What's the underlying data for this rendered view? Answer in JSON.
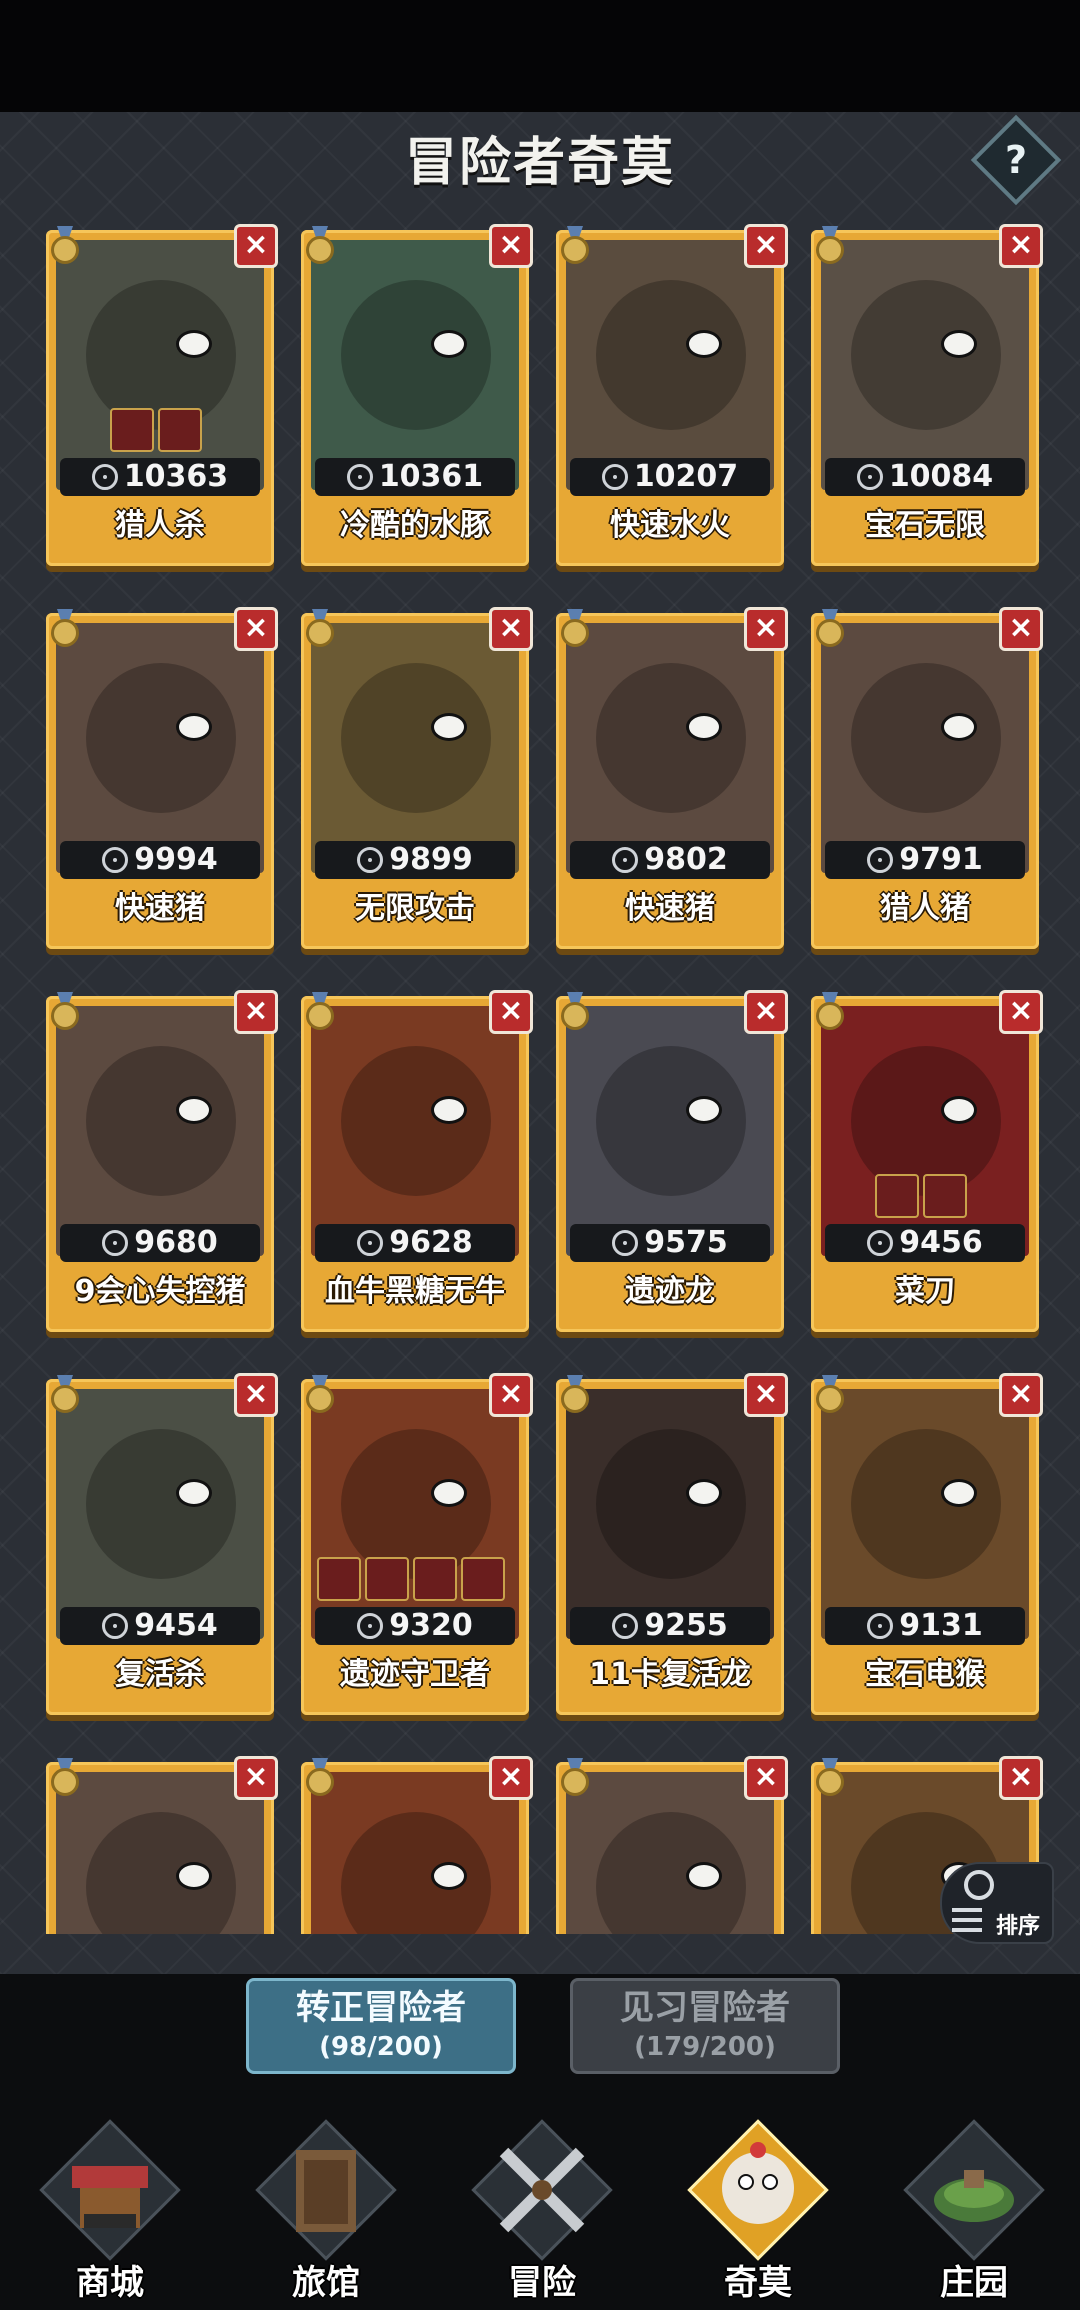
{
  "header": {
    "title": "冒险者奇莫",
    "help_label": "?"
  },
  "cards": [
    {
      "power": "10363",
      "name": "猎人杀",
      "art": "#4b4f45"
    },
    {
      "power": "10361",
      "name": "冷酷的水豚",
      "art": "#3f5a4a"
    },
    {
      "power": "10207",
      "name": "快速水火",
      "art": "#5a4c3e"
    },
    {
      "power": "10084",
      "name": "宝石无限",
      "art": "#5a5046"
    },
    {
      "power": "9994",
      "name": "快速猪",
      "art": "#5c4a40"
    },
    {
      "power": "9899",
      "name": "无限攻击",
      "art": "#6b5a34"
    },
    {
      "power": "9802",
      "name": "快速猪",
      "art": "#5c4a40"
    },
    {
      "power": "9791",
      "name": "猎人猪",
      "art": "#5c4a40"
    },
    {
      "power": "9680",
      "name": "9会心失控猪",
      "art": "#5c4a40"
    },
    {
      "power": "9628",
      "name": "血牛黑糖无牛",
      "art": "#7a3a22"
    },
    {
      "power": "9575",
      "name": "遗迹龙",
      "art": "#4a4a52"
    },
    {
      "power": "9456",
      "name": "菜刀",
      "art": "#7a2020"
    },
    {
      "power": "9454",
      "name": "复活杀",
      "art": "#4b4f45"
    },
    {
      "power": "9320",
      "name": "遗迹守卫者",
      "art": "#7a3a22"
    },
    {
      "power": "9255",
      "name": "11卡复活龙",
      "art": "#3a2e2a"
    },
    {
      "power": "9131",
      "name": "宝石电猴",
      "art": "#6a4a2a"
    },
    {
      "power": "",
      "name": "",
      "art": "#5c4a40"
    },
    {
      "power": "",
      "name": "",
      "art": "#7a3a22"
    },
    {
      "power": "",
      "name": "",
      "art": "#5c4a40"
    },
    {
      "power": "",
      "name": "",
      "art": "#6a4a2a"
    }
  ],
  "close_glyph": "×",
  "sort_label": "排序",
  "tabs": [
    {
      "label": "转正冒险者",
      "count": "(98/200)"
    },
    {
      "label": "见习冒险者",
      "count": "(179/200)"
    }
  ],
  "nav": [
    {
      "label": "商城",
      "icon": "shop-icon"
    },
    {
      "label": "旅馆",
      "icon": "inn-icon"
    },
    {
      "label": "冒险",
      "icon": "adventure-icon"
    },
    {
      "label": "奇莫",
      "icon": "chimo-icon"
    },
    {
      "label": "庄园",
      "icon": "manor-icon"
    }
  ],
  "colors": {
    "card_gold": "#e7a835",
    "close_red": "#b92c2c",
    "active_tab": "#3d6f86"
  }
}
